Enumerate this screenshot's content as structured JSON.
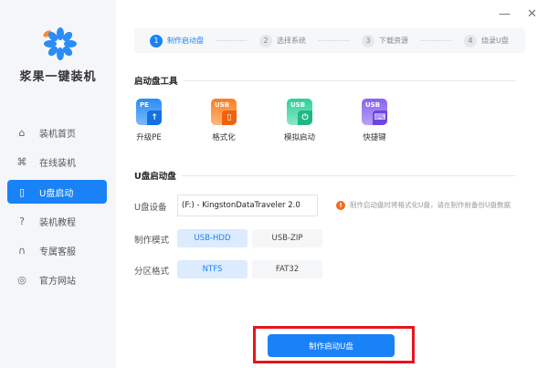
{
  "app": {
    "brand": "浆果一键装机",
    "minimize_icon": "minimize-icon",
    "close_icon": "close-icon"
  },
  "sidebar": {
    "items": [
      {
        "label": "装机首页",
        "icon": "home-icon"
      },
      {
        "label": "在线装机",
        "icon": "online-install-icon"
      },
      {
        "label": "U盘启动",
        "icon": "usb-icon",
        "active": true
      },
      {
        "label": "装机教程",
        "icon": "help-icon"
      },
      {
        "label": "专属客服",
        "icon": "headset-icon"
      },
      {
        "label": "官方网站",
        "icon": "website-icon"
      }
    ]
  },
  "steps": [
    {
      "num": "1",
      "label": "制作启动盘",
      "active": true
    },
    {
      "num": "2",
      "label": "选择系统"
    },
    {
      "num": "3",
      "label": "下载资源"
    },
    {
      "num": "4",
      "label": "烧录U盘"
    }
  ],
  "tools": {
    "title": "启动盘工具",
    "items": [
      {
        "badge": "PE",
        "label": "升级PE",
        "color": "#2a8cf7"
      },
      {
        "badge": "USB",
        "label": "格式化",
        "color": "#fb7d22"
      },
      {
        "badge": "USB",
        "label": "模拟启动",
        "color": "#2ecf9a"
      },
      {
        "badge": "USB",
        "label": "快捷键",
        "color": "#8a63ee"
      }
    ]
  },
  "usb": {
    "title": "U盘启动盘",
    "device_label": "U盘设备",
    "device_value": "(F:) - KingstonDataTraveler 2.0",
    "warning": "制作启动盘时将格式化U盘，请在制作前备份U盘数据",
    "mode_label": "制作模式",
    "modes": [
      "USB-HDD",
      "USB-ZIP"
    ],
    "partition_label": "分区格式",
    "partitions": [
      "NTFS",
      "FAT32"
    ]
  },
  "make_button": "制作启动U盘",
  "colors": {
    "accent": "#1a82f7",
    "highlight": "#e8141c"
  }
}
